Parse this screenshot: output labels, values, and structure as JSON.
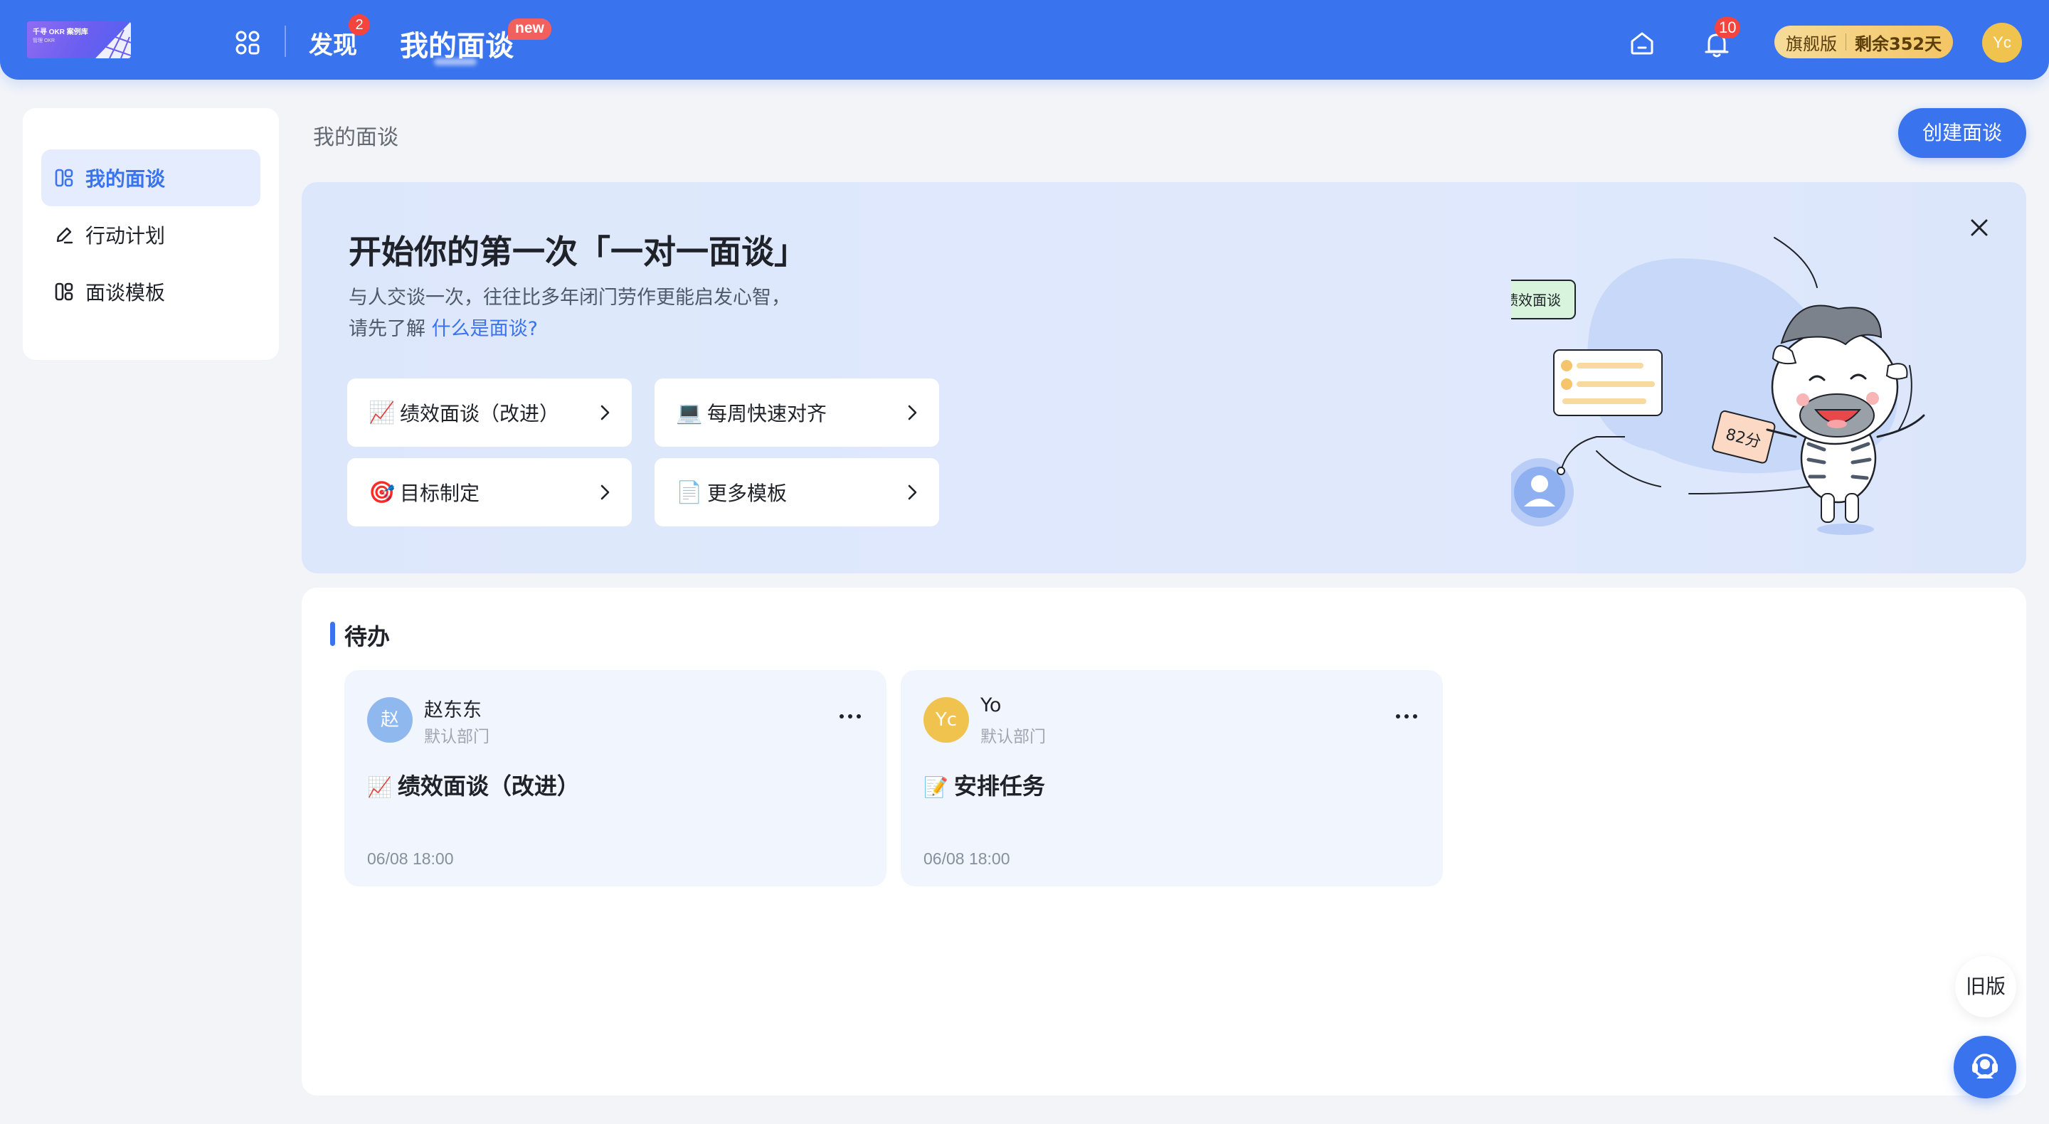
{
  "topbar": {
    "logo_text": "千寻 OKR 案例库",
    "logo_sub": "管理 OKR",
    "nav_discover": "发现",
    "discover_badge": "2",
    "nav_interview": "我的面谈",
    "new_badge": "new",
    "bell_badge": "10",
    "edition_label": "旗舰版",
    "edition_remaining": "剩余352天",
    "user_avatar": "Yc",
    "icons": [
      "apps-icon",
      "home-icon",
      "bell-icon"
    ]
  },
  "sidebar": {
    "items": [
      {
        "label": "我的面谈",
        "icon": "interview-icon",
        "active": true
      },
      {
        "label": "行动计划",
        "icon": "edit-icon",
        "active": false
      },
      {
        "label": "面谈模板",
        "icon": "template-icon",
        "active": false
      }
    ]
  },
  "main": {
    "breadcrumb": "我的面谈",
    "create_button": "创建面谈"
  },
  "banner": {
    "title": "开始你的第一次「一对一面谈」",
    "desc_line1": "与人交谈一次，往往比多年闭门劳作更能启发心智，",
    "desc_line2_prefix": "请先了解",
    "desc_link": "什么是面谈?",
    "templates": [
      {
        "emoji": "📈",
        "label": "绩效面谈（改进）"
      },
      {
        "emoji": "💻",
        "label": "每周快速对齐"
      },
      {
        "emoji": "🎯",
        "label": "目标制定"
      },
      {
        "emoji": "📄",
        "label": "更多模板"
      }
    ],
    "illustration": {
      "tag": "绩效面谈",
      "score": "82分"
    }
  },
  "todo": {
    "title": "待办",
    "tasks": [
      {
        "avatar_text": "赵",
        "avatar_color": "#8fb8ee",
        "name": "赵东东",
        "department": "默认部门",
        "emoji": "📈",
        "title": "绩效面谈（改进）",
        "time": "06/08 18:00"
      },
      {
        "avatar_text": "Yc",
        "avatar_color": "#f0c24e",
        "name": "Yo",
        "department": "默认部门",
        "emoji": "📝",
        "title": "安排任务",
        "time": "06/08 18:00"
      }
    ]
  },
  "floating": {
    "old_version": "旧版"
  },
  "colors": {
    "primary": "#3a73ee",
    "badge_red": "#f5443e",
    "banner_bg": "#dde7fb",
    "card_bg": "#f1f5fd"
  }
}
